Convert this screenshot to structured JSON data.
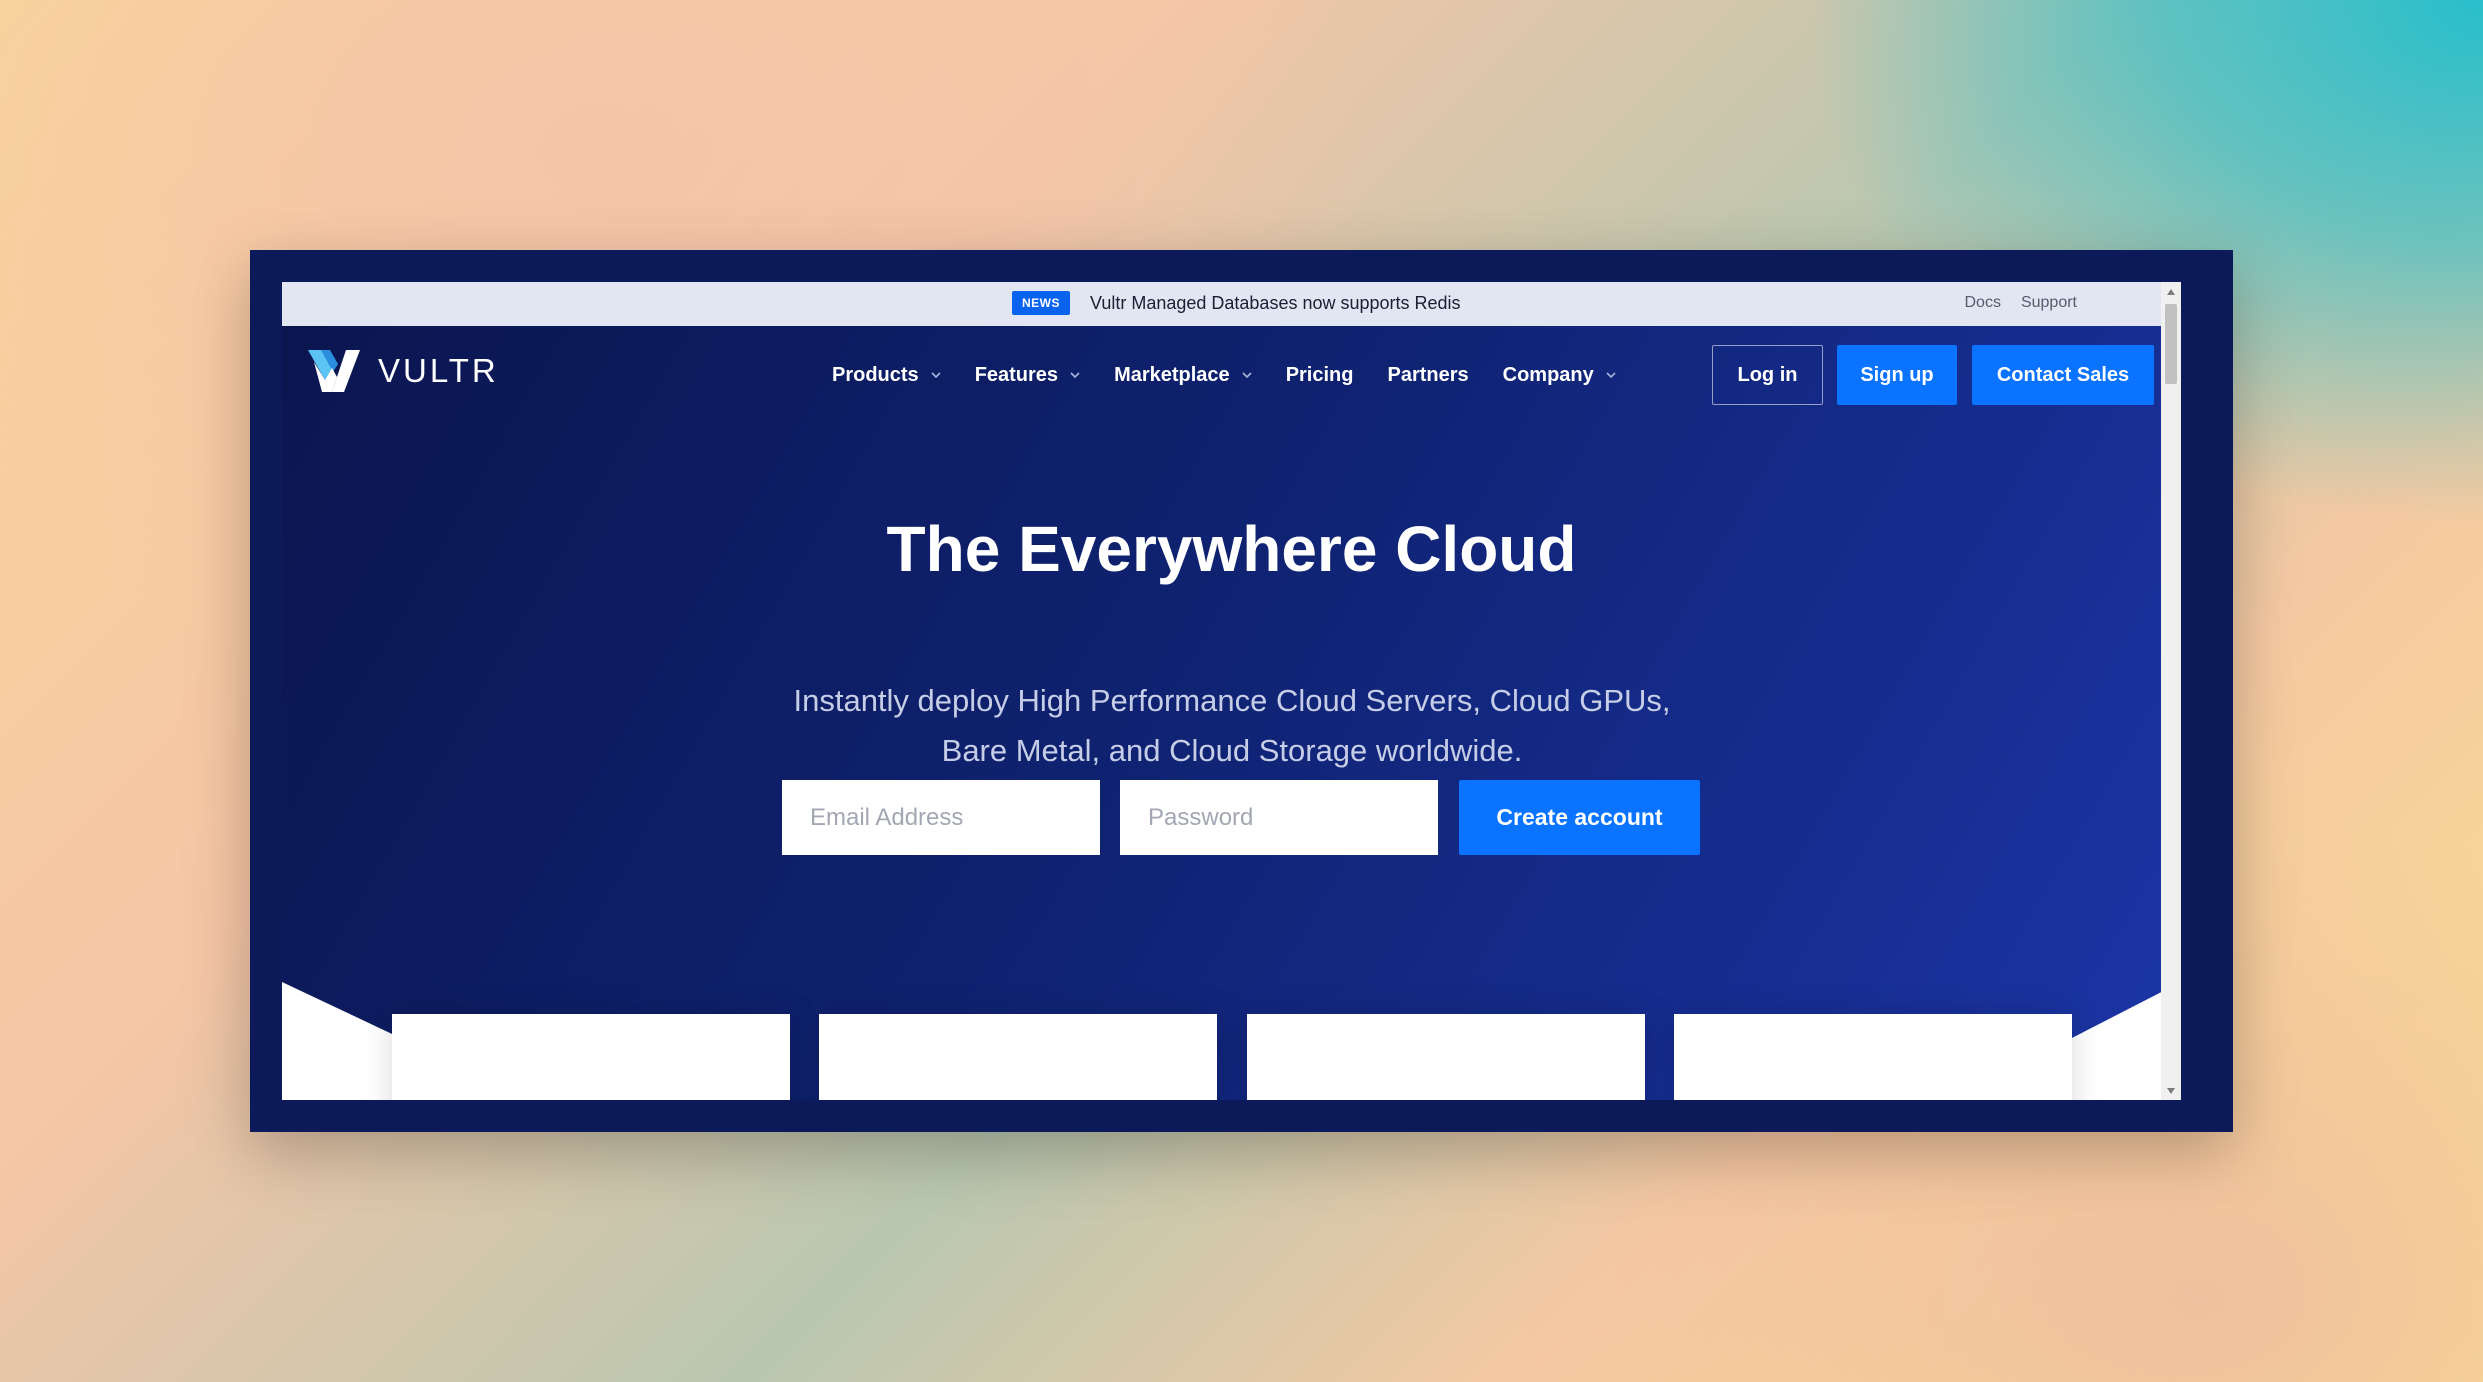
{
  "topbar": {
    "badge": "NEWS",
    "news": "Vultr Managed Databases now supports Redis",
    "links": [
      "Docs",
      "Support"
    ]
  },
  "brand": {
    "name": "VULTR"
  },
  "nav": {
    "items": [
      {
        "label": "Products",
        "dropdown": true
      },
      {
        "label": "Features",
        "dropdown": true
      },
      {
        "label": "Marketplace",
        "dropdown": true
      },
      {
        "label": "Pricing",
        "dropdown": false
      },
      {
        "label": "Partners",
        "dropdown": false
      },
      {
        "label": "Company",
        "dropdown": true
      }
    ],
    "login": "Log in",
    "signup": "Sign up",
    "contact": "Contact Sales"
  },
  "hero": {
    "title": "The Everywhere Cloud",
    "subtitle": "Instantly deploy High Performance Cloud Servers, Cloud GPUs, Bare Metal, and Cloud Storage worldwide.",
    "email_placeholder": "Email Address",
    "password_placeholder": "Password",
    "cta": "Create account"
  },
  "colors": {
    "accent": "#0a73ff",
    "hero_dark": "#0b1650",
    "hero_light": "#1b35a6"
  }
}
